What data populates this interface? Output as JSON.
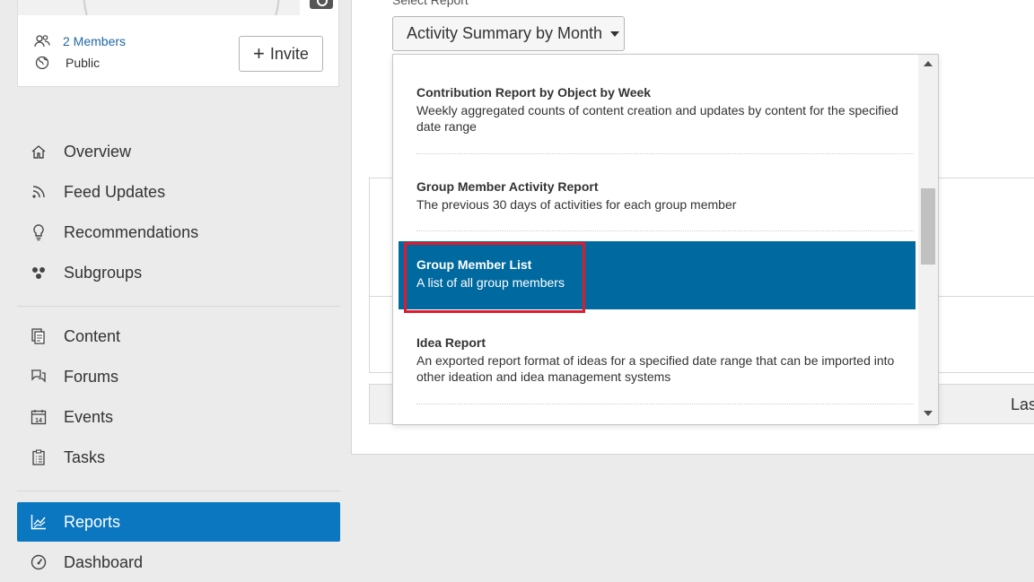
{
  "group_card": {
    "members_label": "2 Members",
    "visibility_label": "Public",
    "invite_label": "Invite"
  },
  "sidebar": {
    "items": [
      {
        "label": "Overview",
        "icon": "home-icon"
      },
      {
        "label": "Feed Updates",
        "icon": "rss-icon"
      },
      {
        "label": "Recommendations",
        "icon": "lightbulb-icon"
      },
      {
        "label": "Subgroups",
        "icon": "subgroups-icon"
      },
      {
        "label": "Content",
        "icon": "content-icon"
      },
      {
        "label": "Forums",
        "icon": "forums-icon"
      },
      {
        "label": "Events",
        "icon": "calendar-icon"
      },
      {
        "label": "Tasks",
        "icon": "tasks-icon"
      },
      {
        "label": "Reports",
        "icon": "reports-chart-icon",
        "active": true
      },
      {
        "label": "Dashboard",
        "icon": "dashboard-icon"
      }
    ]
  },
  "main": {
    "select_label": "Select Report",
    "selected_report": "Activity Summary by Month",
    "table_last_header": "Last"
  },
  "dropdown": {
    "options": [
      {
        "title": "Contribution Report by Object by Week",
        "desc": "Weekly aggregated counts of content creation and updates by content for the specified date range"
      },
      {
        "title": "Group Member Activity Report",
        "desc": "The previous 30 days of activities for each group member"
      },
      {
        "title": "Group Member List",
        "desc": "A list of all group members",
        "selected": true
      },
      {
        "title": "Idea Report",
        "desc": "An exported report format of ideas for a specified date range that can be imported into other ideation and idea management systems"
      }
    ]
  },
  "colors": {
    "accent": "#0b77c1",
    "selected_option": "#006aa0",
    "highlight_border": "#e01a2b"
  }
}
